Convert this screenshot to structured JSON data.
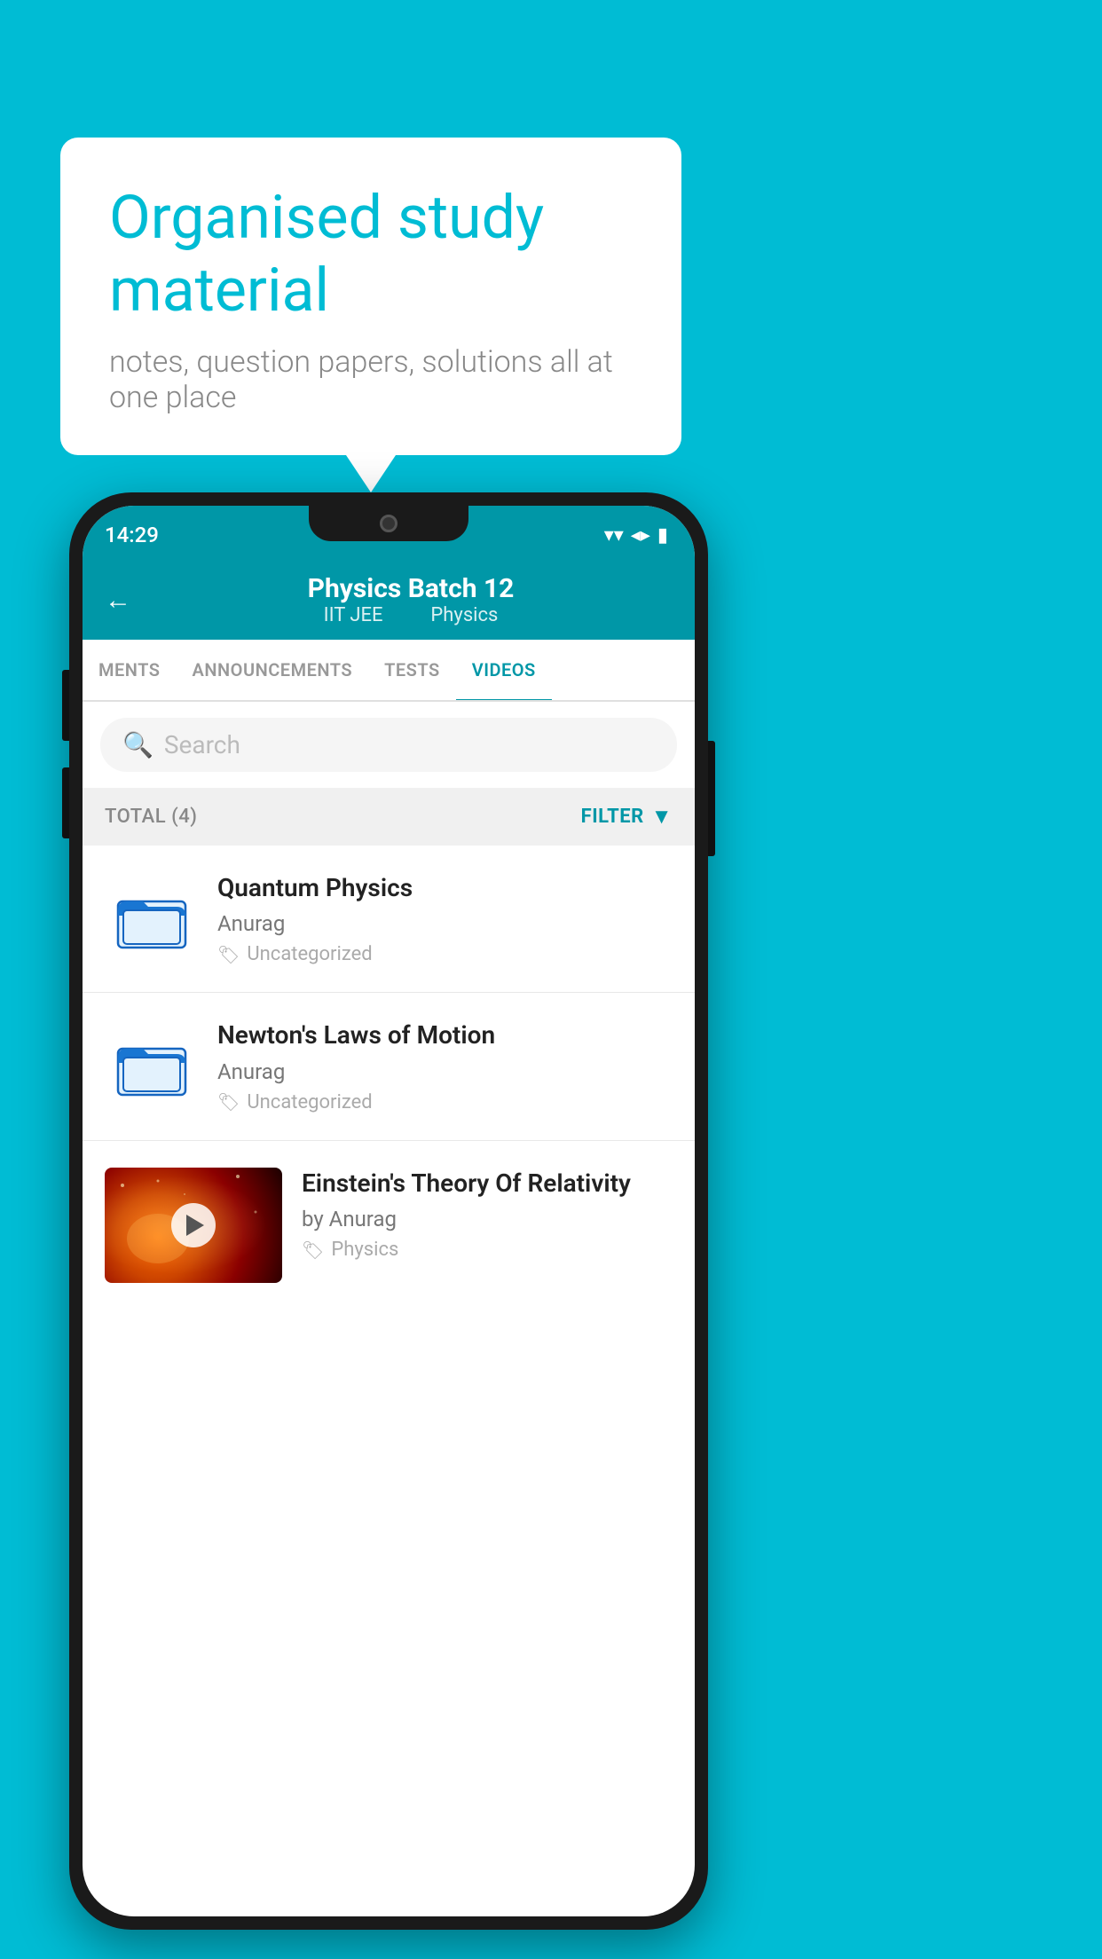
{
  "background_color": "#00bcd4",
  "speech_bubble": {
    "title": "Organised study material",
    "subtitle": "notes, question papers, solutions all at one place"
  },
  "status_bar": {
    "time": "14:29",
    "wifi": "▼",
    "signal": "▲",
    "battery": "▮"
  },
  "header": {
    "back_label": "←",
    "title": "Physics Batch 12",
    "subtitle_part1": "IIT JEE",
    "subtitle_part2": "Physics"
  },
  "tabs": [
    {
      "label": "MENTS",
      "active": false
    },
    {
      "label": "ANNOUNCEMENTS",
      "active": false
    },
    {
      "label": "TESTS",
      "active": false
    },
    {
      "label": "VIDEOS",
      "active": true
    }
  ],
  "search": {
    "placeholder": "Search"
  },
  "filter_bar": {
    "total_label": "TOTAL (4)",
    "filter_label": "FILTER"
  },
  "videos": [
    {
      "id": 1,
      "title": "Quantum Physics",
      "author": "Anurag",
      "tag": "Uncategorized",
      "has_thumbnail": false
    },
    {
      "id": 2,
      "title": "Newton's Laws of Motion",
      "author": "Anurag",
      "tag": "Uncategorized",
      "has_thumbnail": false
    },
    {
      "id": 3,
      "title": "Einstein's Theory Of Relativity",
      "author": "by Anurag",
      "tag": "Physics",
      "has_thumbnail": true
    }
  ]
}
